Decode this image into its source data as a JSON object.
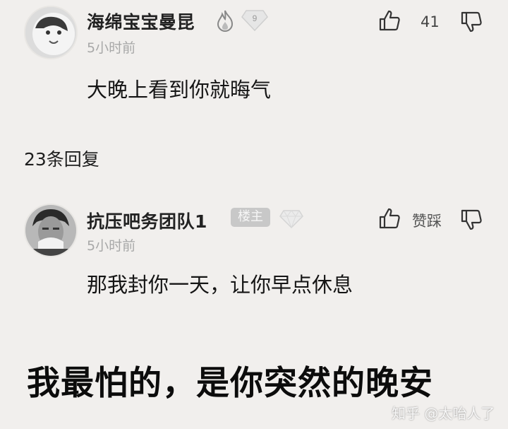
{
  "comment": {
    "username": "海绵宝宝曼昆",
    "time": "5小时前",
    "content": "大晚上看到你就晦气",
    "like_count": "41",
    "level_badge": "9"
  },
  "replies_header": "23条回复",
  "reply": {
    "username": "抗压吧务团队1",
    "owner_badge": "楼主",
    "time": "5小时前",
    "content": "那我封你一天，让你早点休息",
    "like_label": "赞踩"
  },
  "caption": "我最怕的，是你突然的晚安",
  "watermark": "知乎 @太咍人了",
  "icons": {
    "fire": "fire-icon",
    "level": "level-diamond-icon",
    "like": "thumbs-up-icon",
    "dislike": "thumbs-down-icon"
  },
  "colors": {
    "background": "#f1efed",
    "time_text": "#a8a8a8",
    "badge": "#c8c8c8"
  }
}
